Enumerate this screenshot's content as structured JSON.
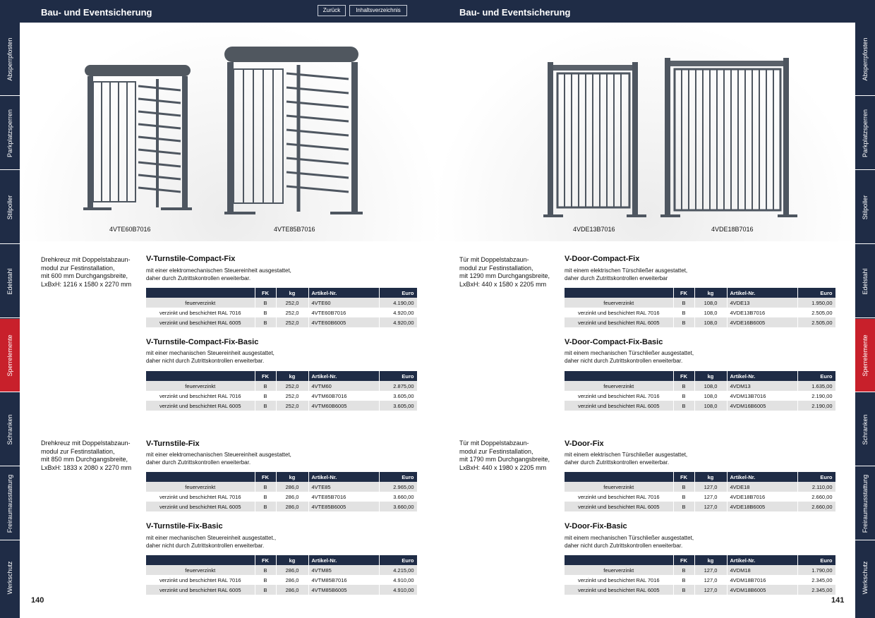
{
  "header": {
    "title_left": "Bau- und Eventsicherung",
    "title_right": "Bau- und Eventsicherung",
    "back_label": "Zurück",
    "toc_label": "Inhaltsverzeichnis"
  },
  "sidebar": {
    "tabs": [
      "Absperrpfosten",
      "Parkplatzsperren",
      "Stilpoller",
      "Edelstahl",
      "Sperrelemente",
      "Schranken",
      "Freiraumausstattung",
      "Werkschutz"
    ],
    "active_index": 4
  },
  "pages": {
    "left": "140",
    "right": "141"
  },
  "captions": {
    "left_1": "4VTE60B7016",
    "left_2": "4VTE85B7016",
    "right_1": "4VDE13B7016",
    "right_2": "4VDE18B7016"
  },
  "table_header": {
    "name": "",
    "fk": "FK",
    "kg": "kg",
    "art": "Artikel-Nr.",
    "euro": "Euro"
  },
  "descriptions": {
    "l1": [
      "Drehkreuz mit Doppelstabzaun-",
      "modul zur Festinstallation,",
      "mit 600 mm Durchgangsbreite,",
      "LxBxH: 1216 x 1580 x 2270 mm"
    ],
    "l2": [
      "Drehkreuz mit Doppelstabzaun-",
      "modul zur Festinstallation,",
      "mit 850 mm Durchgangsbreite,",
      "LxBxH: 1833 x 2080 x 2270 mm"
    ],
    "r1": [
      "Tür mit Doppelstabzaun-",
      "modul zur Festinstallation,",
      "mit 1290 mm Durchgangsbreite,",
      "LxBxH: 440 x 1580 x 2205 mm"
    ],
    "r2": [
      "Tür mit Doppelstabzaun-",
      "modul zur Festinstallation,",
      "mit 1790 mm Durchgangsbreite,",
      "LxBxH: 440 x 1980 x 2205 mm"
    ]
  },
  "sections": [
    {
      "title": "V-Turnstile-Compact-Fix",
      "sub": [
        "mit einer elektromechanischen Steuereinheit ausgestattet,",
        "daher durch Zutrittskontrollen erweiterbar."
      ],
      "rows": [
        [
          "feuerverzinkt",
          "B",
          "252,0",
          "4VTE60",
          "4.190,00"
        ],
        [
          "verzinkt und beschichtet RAL 7016",
          "B",
          "252,0",
          "4VTE60B7016",
          "4.920,00"
        ],
        [
          "verzinkt und beschichtet RAL 6005",
          "B",
          "252,0",
          "4VTE60B6005",
          "4.920,00"
        ]
      ]
    },
    {
      "title": "V-Turnstile-Compact-Fix-Basic",
      "sub": [
        "mit einer mechanischen Steuereinheit ausgestattet,",
        "daher nicht durch Zutrittskontrollen erweiterbar."
      ],
      "rows": [
        [
          "feuerverzinkt",
          "B",
          "252,0",
          "4VTM60",
          "2.875,00"
        ],
        [
          "verzinkt und beschichtet RAL 7016",
          "B",
          "252,0",
          "4VTM60B7016",
          "3.605,00"
        ],
        [
          "verzinkt und beschichtet RAL 6005",
          "B",
          "252,0",
          "4VTM60B6005",
          "3.605,00"
        ]
      ]
    },
    {
      "title": "V-Turnstile-Fix",
      "sub": [
        "mit einer elektromechanischen Steuereinheit ausgestattet,",
        "daher durch Zutrittskontrollen erweiterbar."
      ],
      "rows": [
        [
          "feuerverzinkt",
          "B",
          "286,0",
          "4VTE85",
          "2.965,00"
        ],
        [
          "verzinkt und beschichtet RAL 7016",
          "B",
          "286,0",
          "4VTE85B7016",
          "3.660,00"
        ],
        [
          "verzinkt und beschichtet RAL 6005",
          "B",
          "286,0",
          "4VTE85B6005",
          "3.660,00"
        ]
      ]
    },
    {
      "title": "V-Turnstile-Fix-Basic",
      "sub": [
        "mit einer mechanischen Steuereinheit ausgestattet.,",
        "daher nicht durch Zutrittskontrollen erweiterbar."
      ],
      "rows": [
        [
          "feuerverzinkt",
          "B",
          "286,0",
          "4VTM85",
          "4.215,00"
        ],
        [
          "verzinkt und beschichtet RAL 7016",
          "B",
          "286,0",
          "4VTM85B7016",
          "4.910,00"
        ],
        [
          "verzinkt und beschichtet RAL 6005",
          "B",
          "286,0",
          "4VTM85B6005",
          "4.910,00"
        ]
      ]
    },
    {
      "title": "V-Door-Compact-Fix",
      "sub": [
        "mit einem elektrischen Türschließer ausgestattet,",
        "daher durch Zutrittskontrollen erweiterbar"
      ],
      "rows": [
        [
          "feuerverzinkt",
          "B",
          "108,0",
          "4VDE13",
          "1.950,00"
        ],
        [
          "verzinkt und beschichtet RAL 7016",
          "B",
          "108,0",
          "4VDE13B7016",
          "2.505,00"
        ],
        [
          "verzinkt und beschichtet RAL 6005",
          "B",
          "108,0",
          "4VDE16B6005",
          "2.505,00"
        ]
      ]
    },
    {
      "title": "V-Door-Compact-Fix-Basic",
      "sub": [
        "mit einem mechanischen Türschließer ausgestattet,",
        "daher nicht durch Zutrittskontrollen erweiterbar."
      ],
      "rows": [
        [
          "feuerverzinkt",
          "B",
          "108,0",
          "4VDM13",
          "1.635,00"
        ],
        [
          "verzinkt und beschichtet RAL 7016",
          "B",
          "108,0",
          "4VDM13B7016",
          "2.190,00"
        ],
        [
          "verzinkt und beschichtet RAL 6005",
          "B",
          "108,0",
          "4VDM16B6005",
          "2.190,00"
        ]
      ]
    },
    {
      "title": "V-Door-Fix",
      "sub": [
        "mit einem elektrischen Türschließer ausgestattet,",
        "daher durch Zutrittskontrollen erweiterbar."
      ],
      "rows": [
        [
          "feuerverzinkt",
          "B",
          "127,0",
          "4VDE18",
          "2.110,00"
        ],
        [
          "verzinkt und beschichtet RAL 7016",
          "B",
          "127,0",
          "4VDE18B7016",
          "2.660,00"
        ],
        [
          "verzinkt und beschichtet RAL 6005",
          "B",
          "127,0",
          "4VDE18B6005",
          "2.660,00"
        ]
      ]
    },
    {
      "title": "V-Door-Fix-Basic",
      "sub": [
        "mit einem mechanischen Türschließer ausgestattet,",
        "daher nicht durch Zutrittskontrollen erweiterbar."
      ],
      "rows": [
        [
          "feuerverzinkt",
          "B",
          "127,0",
          "4VDM18",
          "1.790,00"
        ],
        [
          "verzinkt und beschichtet RAL 7016",
          "B",
          "127,0",
          "4VDM18B7016",
          "2.345,00"
        ],
        [
          "verzinkt und beschichtet RAL 6005",
          "B",
          "127,0",
          "4VDM18B6005",
          "2.345,00"
        ]
      ]
    }
  ],
  "colors": {
    "navy": "#1f2c46",
    "active_tab": "#c8202b",
    "row_shade": "#e2e2e2",
    "product_grey": "#4e5660"
  }
}
